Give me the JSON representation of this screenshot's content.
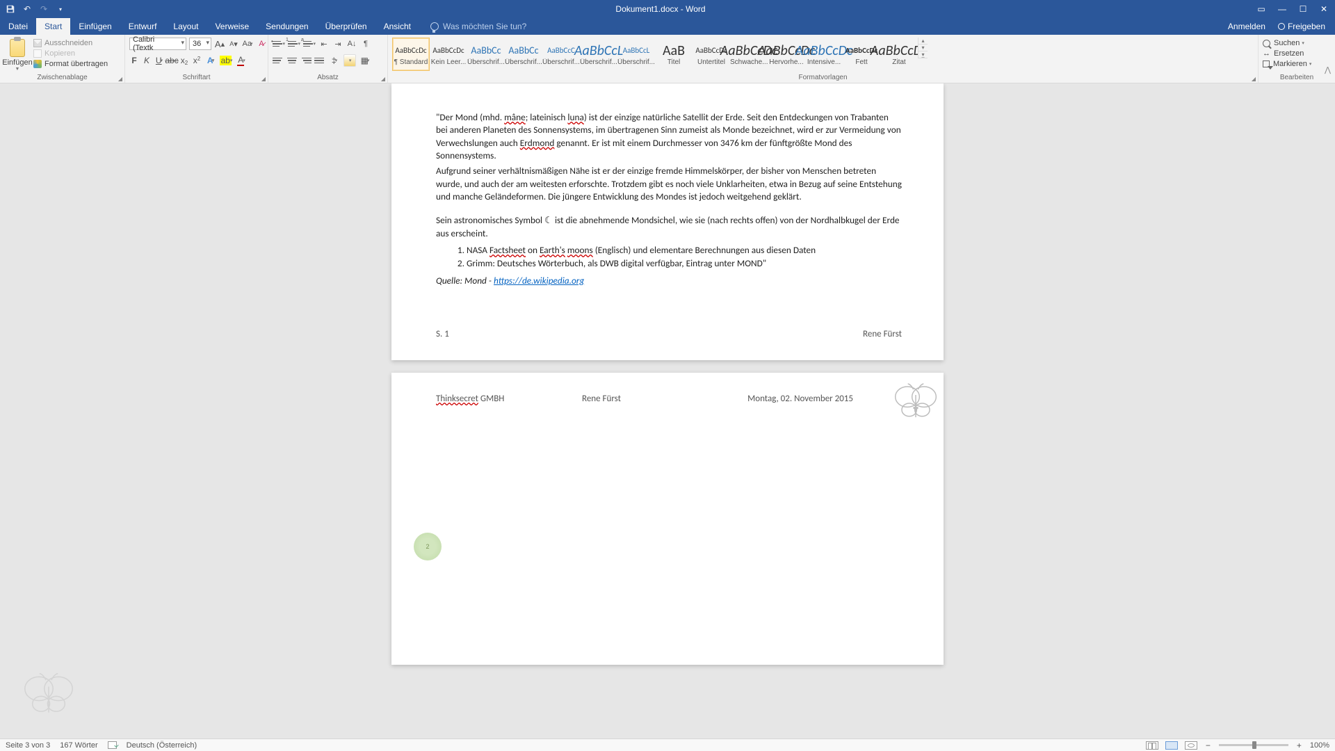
{
  "app": {
    "title": "Dokument1.docx - Word",
    "qat": {
      "save": "💾",
      "undo": "↶",
      "redo": "↷",
      "custom": "▾"
    }
  },
  "tabs": {
    "file": "Datei",
    "home": "Start",
    "insert": "Einfügen",
    "design": "Entwurf",
    "layout": "Layout",
    "references": "Verweise",
    "mailings": "Sendungen",
    "review": "Überprüfen",
    "view": "Ansicht",
    "tell_me": "Was möchten Sie tun?",
    "sign_in": "Anmelden",
    "share": "Freigeben"
  },
  "ribbon": {
    "clipboard": {
      "label": "Zwischenablage",
      "paste": "Einfügen",
      "cut": "Ausschneiden",
      "copy": "Kopieren",
      "format_painter": "Format übertragen"
    },
    "font": {
      "label": "Schriftart",
      "name": "Calibri (Textk",
      "size": "36"
    },
    "paragraph": {
      "label": "Absatz"
    },
    "styles": {
      "label": "Formatvorlagen",
      "items": [
        {
          "preview": "AaBbCcDc",
          "name": "¶ Standard",
          "cls": ""
        },
        {
          "preview": "AaBbCcDc",
          "name": "Kein Leer...",
          "cls": ""
        },
        {
          "preview": "AaBbCc",
          "name": "Überschrif...",
          "cls": "h"
        },
        {
          "preview": "AaBbCc",
          "name": "Überschrif...",
          "cls": "h"
        },
        {
          "preview": "AaBbCcC",
          "name": "Überschrif...",
          "cls": "h"
        },
        {
          "preview": "AaBbCcL",
          "name": "Überschrif...",
          "cls": "h it"
        },
        {
          "preview": "AaBbCcL",
          "name": "Überschrif...",
          "cls": "h"
        },
        {
          "preview": "AaB",
          "name": "Titel",
          "cls": "t"
        },
        {
          "preview": "AaBbCcDc",
          "name": "Untertitel",
          "cls": ""
        },
        {
          "preview": "AaBbCcDc",
          "name": "Schwache...",
          "cls": "it"
        },
        {
          "preview": "AaBbCcDc",
          "name": "Hervorhe...",
          "cls": "it"
        },
        {
          "preview": "AaBbCcDc",
          "name": "Intensive...",
          "cls": "h it"
        },
        {
          "preview": "AaBbCcDc",
          "name": "Fett",
          "cls": "b"
        },
        {
          "preview": "AaBbCcDc",
          "name": "Zitat",
          "cls": "it"
        }
      ]
    },
    "editing": {
      "label": "Bearbeiten",
      "find": "Suchen",
      "replace": "Ersetzen",
      "select": "Markieren"
    }
  },
  "document": {
    "p1": "\"Der Mond (mhd. ",
    "p1_u1": "mâne",
    "p1_b": "; lateinisch ",
    "p1_u2": "luna",
    "p1_c": ") ist der einzige natürliche Satellit der Erde. Seit den Entdeckungen von Trabanten bei anderen Planeten des Sonnensystems, im übertragenen Sinn zumeist als Monde bezeichnet, wird er zur Vermeidung von Verwechslungen auch ",
    "p1_u3": "Erdmond",
    "p1_d": " genannt. Er ist mit einem Durchmesser von 3476 km der fünftgrößte Mond des Sonnensystems.",
    "p2": "Aufgrund seiner verhältnismäßigen Nähe ist er der einzige fremde Himmelskörper, der bisher von Menschen betreten wurde, und auch der am weitesten erforschte. Trotzdem gibt es noch viele Unklarheiten, etwa in Bezug auf seine Entstehung und manche Geländeformen. Die jüngere Entwicklung des Mondes ist jedoch weitgehend geklärt.",
    "p3": "Sein astronomisches Symbol ☾ ist die abnehmende Mondsichel, wie sie (nach rechts offen) von der Nordhalbkugel der Erde aus erscheint.",
    "li1_a": "NASA ",
    "li1_u1": "Factsheet",
    "li1_b": " on ",
    "li1_u2": "Earth's",
    "li1_c": " ",
    "li1_u3": "moons",
    "li1_d": " (Englisch) und elementare Berechnungen aus diesen Daten",
    "li2": "Grimm: Deutsches Wörterbuch, als DWB digital verfügbar, Eintrag unter MOND\"",
    "src_a": "Quelle: Mond - ",
    "src_link": "https://de.wikipedia.org",
    "footer_page": "S. 1",
    "footer_author": "Rene Fürst",
    "header2_company_u": "Thinksecret",
    "header2_company_b": " GMBH",
    "header2_author": "Rene Fürst",
    "header2_date": "Montag, 02. November 2015"
  },
  "status": {
    "page": "Seite 3 von 3",
    "words": "167 Wörter",
    "lang": "Deutsch (Österreich)",
    "zoom": "100%"
  },
  "colors": {
    "brand": "#2b579a"
  }
}
